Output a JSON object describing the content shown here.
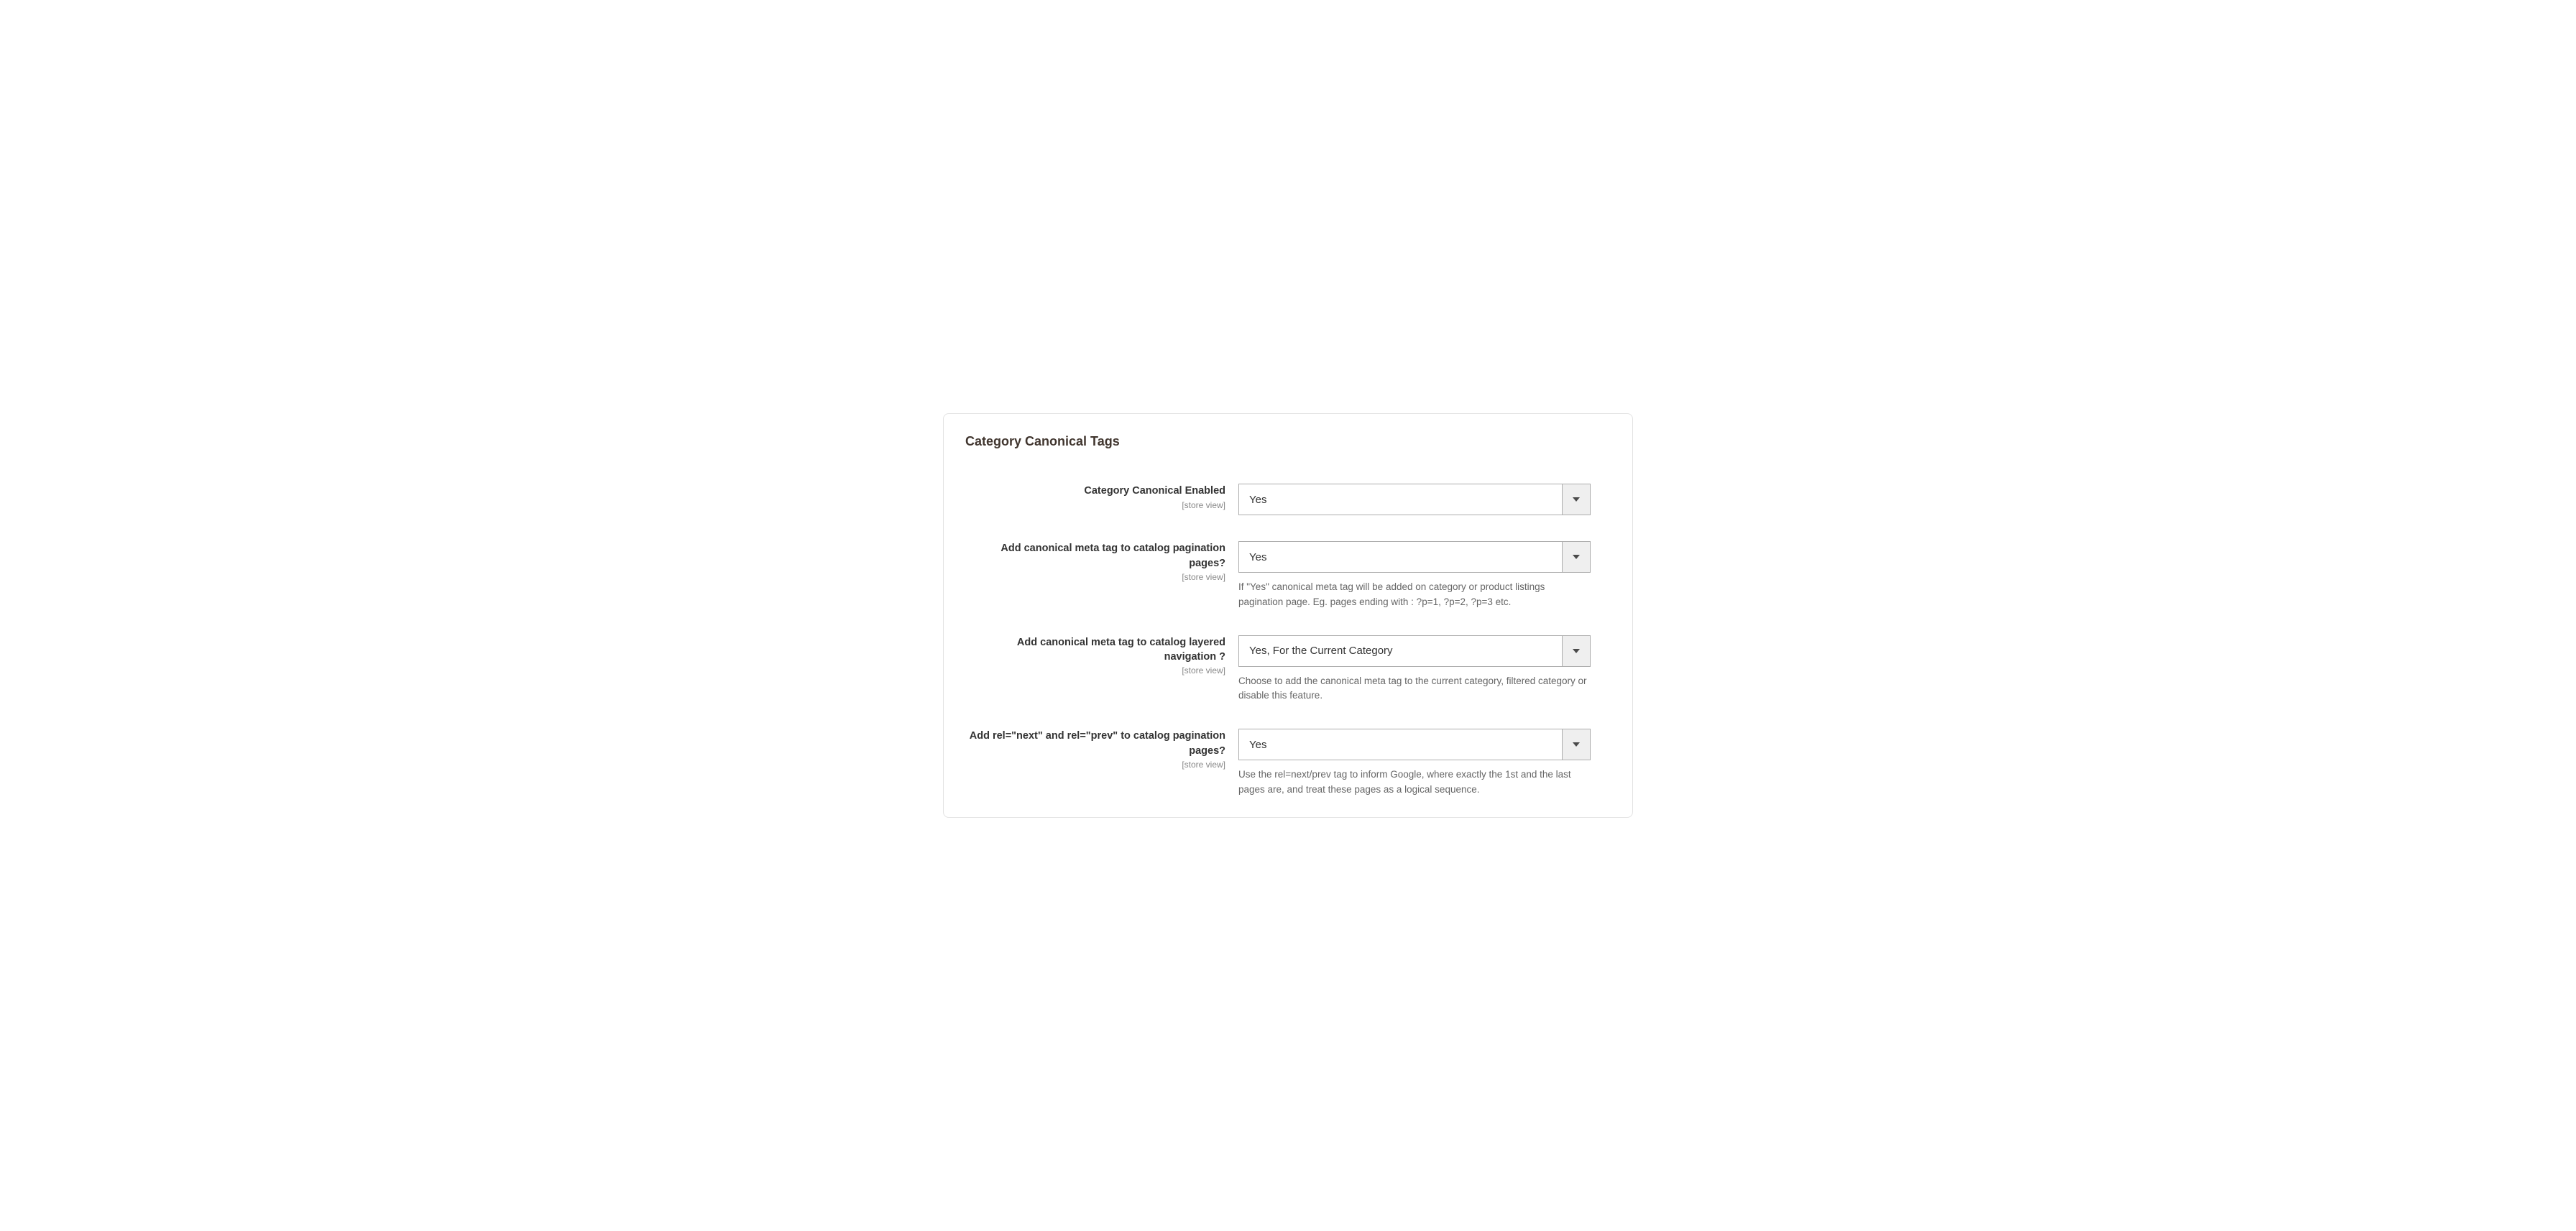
{
  "panel": {
    "title": "Category Canonical Tags"
  },
  "fields": {
    "canonical_enabled": {
      "label": "Category Canonical Enabled",
      "scope": "[store view]",
      "value": "Yes"
    },
    "pagination_canonical": {
      "label": "Add canonical meta tag to catalog pagination pages?",
      "scope": "[store view]",
      "value": "Yes",
      "note": "If \"Yes\" canonical meta tag will be added on category or product listings pagination page. Eg. pages ending with : ?p=1, ?p=2, ?p=3 etc."
    },
    "layered_nav_canonical": {
      "label": "Add canonical meta tag to catalog layered navigation ?",
      "scope": "[store view]",
      "value": "Yes, For the Current Category",
      "note": "Choose to add the canonical meta tag to the current category, filtered category or disable this feature."
    },
    "rel_next_prev": {
      "label": "Add rel=\"next\" and rel=\"prev\" to catalog pagination pages?",
      "scope": "[store view]",
      "value": "Yes",
      "note": "Use the rel=next/prev tag to inform Google, where exactly the 1st and the last pages are, and treat these pages as a logical sequence."
    }
  }
}
